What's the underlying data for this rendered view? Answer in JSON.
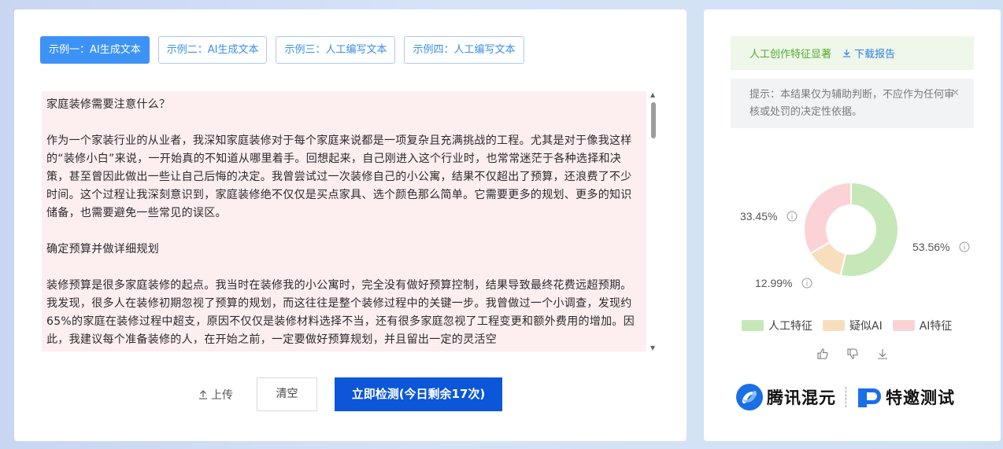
{
  "tabs": [
    {
      "label": "示例一：AI生成文本",
      "active": true
    },
    {
      "label": "示例二：AI生成文本",
      "active": false
    },
    {
      "label": "示例三：人工编写文本",
      "active": false
    },
    {
      "label": "示例四：人工编写文本",
      "active": false
    }
  ],
  "editor": {
    "paragraphs": [
      "家庭装修需要注意什么？",
      "",
      "作为一个家装行业的从业者，我深知家庭装修对于每个家庭来说都是一项复杂且充满挑战的工程。尤其是对于像我这样的“装修小白”来说，一开始真的不知道从哪里着手。回想起来，自己刚进入这个行业时，也常常迷茫于各种选择和决策，甚至曾因此做出一些让自己后悔的决定。我曾尝试过一次装修自己的小公寓，结果不仅超出了预算，还浪费了不少时间。这个过程让我深刻意识到，家庭装修绝不仅仅是买点家具、选个颜色那么简单。它需要更多的规划、更多的知识储备，也需要避免一些常见的误区。",
      "",
      "确定预算并做详细规划",
      "",
      "装修预算是很多家庭装修的起点。我当时在装修我的小公寓时，完全没有做好预算控制，结果导致最终花费远超预期。我发现，很多人在装修初期忽视了预算的规划，而这往往是整个装修过程中的关键一步。我曾做过一个小调查，发现约65%的家庭在装修过程中超支，原因不仅仅是装修材料选择不当，还有很多家庭忽视了工程变更和额外费用的增加。因此，我建议每个准备装修的人，在开始之前，一定要做好预算规划，并且留出一定的灵活空"
    ]
  },
  "actions": {
    "upload_label": "上传",
    "clear_label": "清空",
    "detect_label": "立即检测(今日剩余17次)"
  },
  "result": {
    "banner_text": "人工创作特征显著",
    "download_label": "下载报告",
    "tip_text": "提示：本结果仅为辅助判断，不应作为任何审核或处罚的决定性依据。"
  },
  "chart_data": {
    "type": "pie",
    "donut": true,
    "slices": [
      {
        "label": "人工特征",
        "value": 53.56,
        "display": "53.56%",
        "color": "#c6e7b8"
      },
      {
        "label": "疑似AI",
        "value": 12.99,
        "display": "12.99%",
        "color": "#f7dfbe"
      },
      {
        "label": "AI特征",
        "value": 33.45,
        "display": "33.45%",
        "color": "#fbd3d6"
      }
    ],
    "legend_position": "bottom"
  },
  "brand": {
    "left": "腾讯混元",
    "right": "特邀测试"
  }
}
